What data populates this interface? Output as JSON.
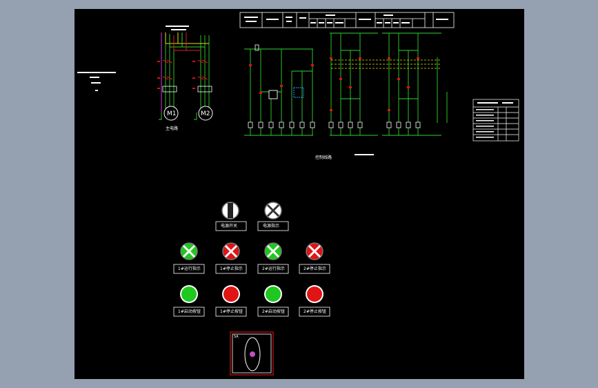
{
  "colors": {
    "background": "#95a0b0",
    "sheet": "#000000",
    "wire_green": "#2fd62f",
    "wire_yellow": "#e6e600",
    "wire_red": "#e02020",
    "wire_magenta": "#d040d0",
    "contact_red": "#e01010",
    "text_white": "#ffffff",
    "lamp_green": "#1ec81e",
    "lamp_red": "#e01414",
    "lamp_white": "#f0f0f0",
    "joystick_frame": "#d01010",
    "joystick_knob": "#c050c0"
  },
  "power_circuit": {
    "motor_labels": [
      "M1",
      "M2"
    ],
    "caption": "主电路"
  },
  "control_circuit": {
    "caption": "控制线路"
  },
  "panel": {
    "row1": [
      {
        "icon": "selector-switch-icon",
        "label": "电源开关"
      },
      {
        "icon": "lamp-white-icon",
        "label": "电源指示"
      }
    ],
    "row2": [
      {
        "icon": "lamp-green-icon",
        "label": "1#运行指示"
      },
      {
        "icon": "lamp-red-icon",
        "label": "1#停止指示"
      },
      {
        "icon": "lamp-green-icon",
        "label": "2#运行指示"
      },
      {
        "icon": "lamp-red-icon",
        "label": "2#停止指示"
      }
    ],
    "row3": [
      {
        "icon": "button-green-icon",
        "label": "1#启动按钮"
      },
      {
        "icon": "button-red-icon",
        "label": "1#停止按钮"
      },
      {
        "icon": "button-green-icon",
        "label": "2#启动按钮"
      },
      {
        "icon": "button-red-icon",
        "label": "2#停止按钮"
      }
    ],
    "joystick": {
      "icon": "joystick-icon",
      "label": "SA"
    }
  }
}
